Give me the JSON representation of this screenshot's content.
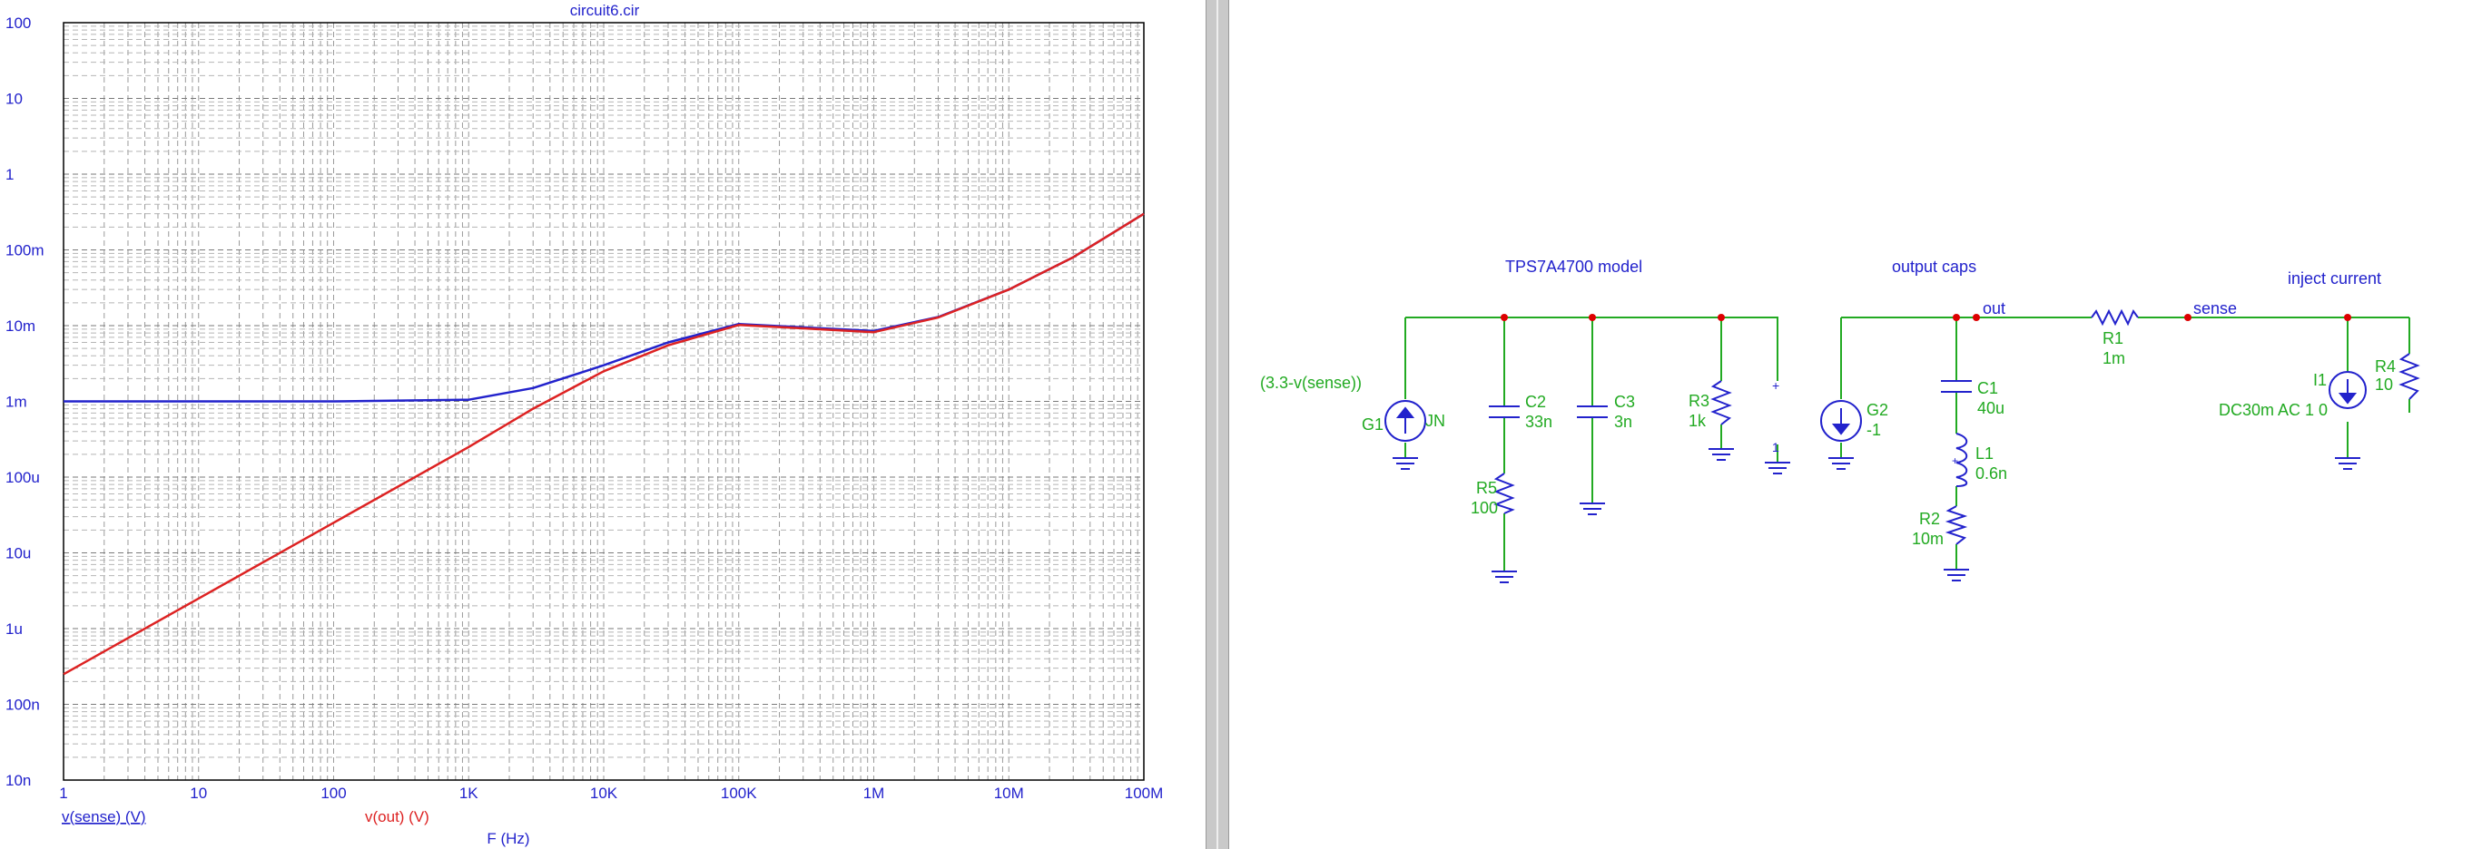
{
  "plot": {
    "title": "circuit6.cir",
    "x_axis_label": "F (Hz)",
    "traces": [
      {
        "label": "v(sense) (V)",
        "color": "#2222cc"
      },
      {
        "label": "v(out) (V)",
        "color": "#dd2222"
      }
    ],
    "x_ticks": [
      "1",
      "10",
      "100",
      "1K",
      "10K",
      "100K",
      "1M",
      "10M",
      "100M"
    ],
    "y_ticks": [
      "100",
      "10",
      "1",
      "100m",
      "10m",
      "1m",
      "100u",
      "10u",
      "1u",
      "100n",
      "10n"
    ]
  },
  "chart_data": {
    "type": "line",
    "title": "circuit6.cir",
    "xlabel": "F (Hz)",
    "ylabel": "",
    "x_scale": "log",
    "y_scale": "log",
    "xlim": [
      1,
      100000000
    ],
    "ylim": [
      1e-08,
      100
    ],
    "grid": true,
    "series": [
      {
        "name": "v(sense) (V)",
        "color": "#2222cc",
        "x": [
          1,
          10,
          100,
          1000,
          3000,
          10000,
          30000,
          100000,
          300000,
          1000000,
          3000000,
          10000000,
          30000000,
          100000000
        ],
        "y": [
          0.001,
          0.001,
          0.001,
          0.00105,
          0.0015,
          0.003,
          0.006,
          0.0105,
          0.0095,
          0.0085,
          0.013,
          0.03,
          0.08,
          0.3
        ]
      },
      {
        "name": "v(out) (V)",
        "color": "#dd2222",
        "x": [
          1,
          10,
          100,
          1000,
          3000,
          10000,
          30000,
          100000,
          300000,
          1000000,
          3000000,
          10000000,
          30000000,
          100000000
        ],
        "y": [
          2.5e-07,
          2.5e-06,
          2.5e-05,
          0.00025,
          0.0008,
          0.0025,
          0.0055,
          0.0102,
          0.0092,
          0.0082,
          0.0128,
          0.03,
          0.08,
          0.3
        ]
      }
    ]
  },
  "schematic": {
    "labels": {
      "model": "TPS7A4700 model",
      "caps": "output caps",
      "inject": "inject current",
      "out": "out",
      "sense": "sense",
      "g1_expr": "(3.3-v(sense))"
    },
    "components": {
      "G1": {
        "name": "G1",
        "value": "JN"
      },
      "C2": {
        "name": "C2",
        "value": "33n"
      },
      "R5": {
        "name": "R5",
        "value": "100"
      },
      "C3": {
        "name": "C3",
        "value": "3n"
      },
      "R3": {
        "name": "R3",
        "value": "1k"
      },
      "G2": {
        "name": "G2",
        "value": "-1"
      },
      "C1": {
        "name": "C1",
        "value": "40u"
      },
      "L1": {
        "name": "L1",
        "value": "0.6n"
      },
      "R2": {
        "name": "R2",
        "value": "10m"
      },
      "R1": {
        "name": "R1",
        "value": "1m"
      },
      "I1": {
        "name": "I1",
        "value": "DC30m AC 1 0"
      },
      "R4": {
        "name": "R4",
        "value": "10"
      }
    },
    "colors": {
      "wire": "#22aa22",
      "component": "#2222cc",
      "node": "#dd0000",
      "text": "#2222cc"
    }
  }
}
